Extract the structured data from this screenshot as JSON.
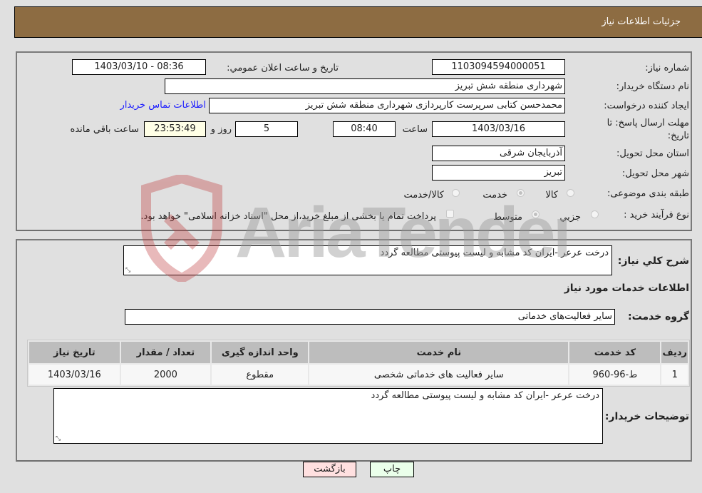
{
  "header": {
    "title": "جزئیات اطلاعات نیاز"
  },
  "form": {
    "need_number": {
      "label": "شماره نیاز:",
      "value": "1103094594000051"
    },
    "announce_datetime": {
      "label": "تاریخ و ساعت اعلان عمومي:",
      "value": "1403/03/10 - 08:36"
    },
    "buyer_org": {
      "label": "نام دستگاه خريدار:",
      "value": "شهرداری منطقه شش تبریز"
    },
    "requester": {
      "label": "ایجاد کننده درخواست:",
      "value": "محمدحسن کتابی سرپرست کارپردازی شهرداری منطقه شش تبریز"
    },
    "buyer_contact_link": "اطلاعات تماس خریدار",
    "deadline": {
      "label_line1": "مهلت ارسال پاسخ: تا",
      "label_line2": "تاریخ:",
      "date": "1403/03/16",
      "time_label": "ساعت",
      "time": "08:40",
      "days": "5",
      "days_label": "روز و",
      "remaining": "23:53:49",
      "remaining_label": "ساعت باقي مانده"
    },
    "province": {
      "label": "استان محل تحویل:",
      "value": "آذربایجان شرقی"
    },
    "city": {
      "label": "شهر محل تحویل:",
      "value": "تبریز"
    },
    "category": {
      "label": "طبقه بندی موضوعی:",
      "options": [
        "کالا",
        "خدمت",
        "کالا/خدمت"
      ],
      "selected": "خدمت"
    },
    "purchase_type": {
      "label": "نوع فرآیند خرید :",
      "options": [
        "جزيي",
        "متوسط"
      ],
      "selected": "متوسط",
      "treasury_note": "پرداخت تمام یا بخشی از مبلغ خرید،از محل \"اسناد خزانه اسلامی\" خواهد بود."
    }
  },
  "details": {
    "general_desc_label": "شرح کلي نياز:",
    "general_desc": "درخت عرعر -ایران کد مشابه و لیست پیوستی مطالعه گردد",
    "services_title": "اطلاعات خدمات مورد نياز",
    "service_group_label": "گروه خدمت:",
    "service_group": "سایر فعالیت‌های خدماتی",
    "table": {
      "headers": [
        "رديف",
        "کد خدمت",
        "نام خدمت",
        "واحد اندازه گيری",
        "تعداد / مقدار",
        "تاريخ نياز"
      ],
      "rows": [
        [
          "1",
          "ط-96-960",
          "سایر فعالیت های خدماتی شخصی",
          "مقطوع",
          "2000",
          "1403/03/16"
        ]
      ]
    },
    "buyer_notes_label": "توضيحات خريدار:",
    "buyer_notes": "درخت عرعر -ایران کد مشابه و لیست پیوستی مطالعه گردد"
  },
  "buttons": {
    "print": "چاپ",
    "back": "بازگشت"
  },
  "watermark": "AriaTender.neT",
  "colors": {
    "header_bg": "#8d6c42",
    "print_bg": "#eaffea",
    "back_bg": "#ffe0e0",
    "link": "#1a1aff"
  }
}
